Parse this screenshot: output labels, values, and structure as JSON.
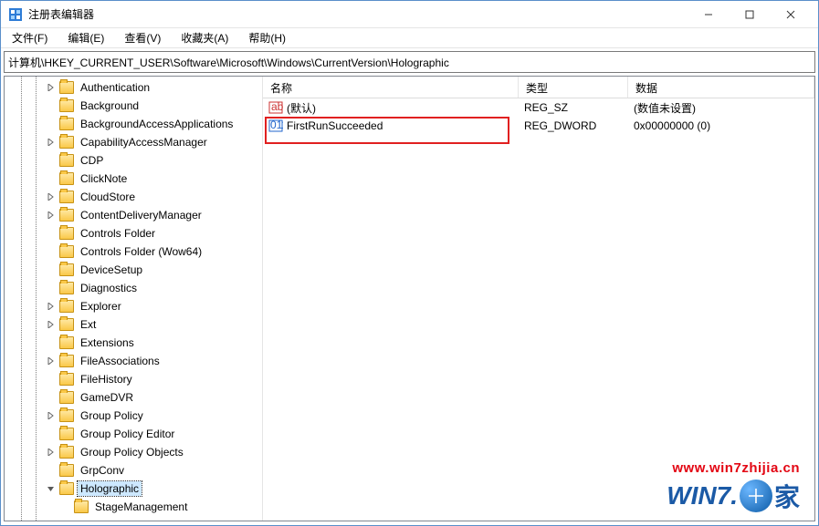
{
  "window": {
    "title": "注册表编辑器"
  },
  "menu": {
    "file": "文件(F)",
    "edit": "编辑(E)",
    "view": "查看(V)",
    "favorites": "收藏夹(A)",
    "help": "帮助(H)"
  },
  "address": "计算机\\HKEY_CURRENT_USER\\Software\\Microsoft\\Windows\\CurrentVersion\\Holographic",
  "columns": {
    "name": "名称",
    "type": "类型",
    "data": "数据"
  },
  "tree": {
    "items": [
      {
        "indent": 1,
        "exp": ">",
        "label": "Authentication"
      },
      {
        "indent": 1,
        "exp": "",
        "label": "Background"
      },
      {
        "indent": 1,
        "exp": "",
        "label": "BackgroundAccessApplications"
      },
      {
        "indent": 1,
        "exp": ">",
        "label": "CapabilityAccessManager"
      },
      {
        "indent": 1,
        "exp": "",
        "label": "CDP"
      },
      {
        "indent": 1,
        "exp": "",
        "label": "ClickNote"
      },
      {
        "indent": 1,
        "exp": ">",
        "label": "CloudStore"
      },
      {
        "indent": 1,
        "exp": ">",
        "label": "ContentDeliveryManager"
      },
      {
        "indent": 1,
        "exp": "",
        "label": "Controls Folder"
      },
      {
        "indent": 1,
        "exp": "",
        "label": "Controls Folder (Wow64)"
      },
      {
        "indent": 1,
        "exp": "",
        "label": "DeviceSetup"
      },
      {
        "indent": 1,
        "exp": "",
        "label": "Diagnostics"
      },
      {
        "indent": 1,
        "exp": ">",
        "label": "Explorer"
      },
      {
        "indent": 1,
        "exp": ">",
        "label": "Ext"
      },
      {
        "indent": 1,
        "exp": "",
        "label": "Extensions"
      },
      {
        "indent": 1,
        "exp": ">",
        "label": "FileAssociations"
      },
      {
        "indent": 1,
        "exp": "",
        "label": "FileHistory"
      },
      {
        "indent": 1,
        "exp": "",
        "label": "GameDVR"
      },
      {
        "indent": 1,
        "exp": ">",
        "label": "Group Policy"
      },
      {
        "indent": 1,
        "exp": "",
        "label": "Group Policy Editor"
      },
      {
        "indent": 1,
        "exp": ">",
        "label": "Group Policy Objects"
      },
      {
        "indent": 1,
        "exp": "",
        "label": "GrpConv"
      },
      {
        "indent": 1,
        "exp": "v",
        "label": "Holographic",
        "selected": true
      },
      {
        "indent": 2,
        "exp": "",
        "label": "StageManagement"
      }
    ]
  },
  "values": [
    {
      "icon": "sz",
      "name": "(默认)",
      "type": "REG_SZ",
      "data": "(数值未设置)"
    },
    {
      "icon": "dw",
      "name": "FirstRunSucceeded",
      "type": "REG_DWORD",
      "data": "0x00000000 (0)"
    }
  ],
  "watermark": {
    "url": "www.win7zhijia.cn",
    "logo_left": "WIN7.",
    "logo_right": "家"
  }
}
